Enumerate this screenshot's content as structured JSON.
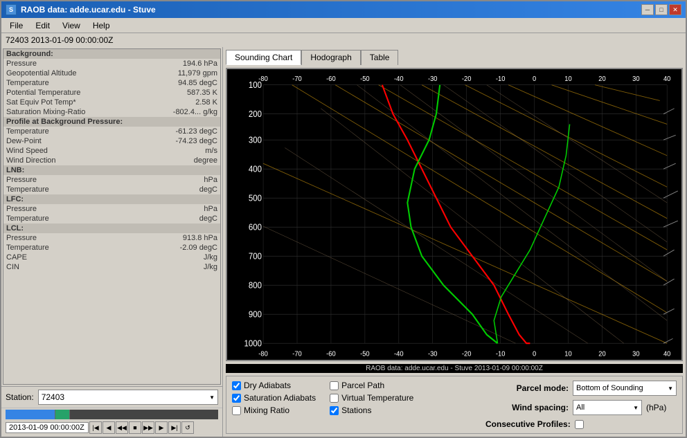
{
  "titleBar": {
    "title": "RAOB data: adde.ucar.edu - Stuve",
    "minimizeBtn": "─",
    "maximizeBtn": "□",
    "closeBtn": "✕"
  },
  "menuBar": {
    "items": [
      "File",
      "Edit",
      "View",
      "Help"
    ]
  },
  "stationInfo": "72403 2013-01-09 00:00:00Z",
  "leftPanel": {
    "sections": [
      {
        "type": "header",
        "label": "Background:",
        "value": ""
      },
      {
        "type": "row",
        "label": "Pressure",
        "value": "194.6 hPa"
      },
      {
        "type": "row",
        "label": "Geopotential Altitude",
        "value": "11,979 gpm"
      },
      {
        "type": "row",
        "label": "Temperature",
        "value": "94.85 degC"
      },
      {
        "type": "row",
        "label": "Potential Temperature",
        "value": "587.35 K"
      },
      {
        "type": "row",
        "label": "Sat Equiv Pot Temp*",
        "value": "2.58 K"
      },
      {
        "type": "row",
        "label": "Saturation Mixing-Ratio",
        "value": "-802.4... g/kg"
      },
      {
        "type": "header",
        "label": "Profile at Background Pressure:",
        "value": ""
      },
      {
        "type": "row",
        "label": "Temperature",
        "value": "-61.23 degC"
      },
      {
        "type": "row",
        "label": "Dew-Point",
        "value": "-74.23 degC"
      },
      {
        "type": "row",
        "label": "Wind Speed",
        "value": "m/s"
      },
      {
        "type": "row",
        "label": "Wind Direction",
        "value": "degree"
      },
      {
        "type": "header",
        "label": "LNB:",
        "value": ""
      },
      {
        "type": "row",
        "label": "Pressure",
        "value": "hPa"
      },
      {
        "type": "row",
        "label": "Temperature",
        "value": "degC"
      },
      {
        "type": "header",
        "label": "LFC:",
        "value": ""
      },
      {
        "type": "row",
        "label": "Pressure",
        "value": "hPa"
      },
      {
        "type": "row",
        "label": "Temperature",
        "value": "degC"
      },
      {
        "type": "header",
        "label": "LCL:",
        "value": ""
      },
      {
        "type": "row",
        "label": "Pressure",
        "value": "913.8 hPa"
      },
      {
        "type": "row",
        "label": "Temperature",
        "value": "-2.09 degC"
      },
      {
        "type": "row",
        "label": "CAPE",
        "value": "J/kg"
      },
      {
        "type": "row",
        "label": "CIN",
        "value": "J/kg"
      }
    ]
  },
  "stationSelect": {
    "label": "Station:",
    "value": "72403"
  },
  "timeDisplay": "2013-01-09 00:00:00Z",
  "tabs": {
    "items": [
      "Sounding Chart",
      "Hodograph",
      "Table"
    ],
    "active": 0
  },
  "chartFooter": "RAOB data: adde.ucar.edu - Stuve 2013-01-09 00:00:00Z",
  "bottomControls": {
    "checkboxGroups": [
      [
        {
          "label": "Dry Adiabats",
          "checked": true
        },
        {
          "label": "Saturation Adiabats",
          "checked": true
        },
        {
          "label": "Mixing Ratio",
          "checked": false
        }
      ],
      [
        {
          "label": "Parcel Path",
          "checked": false
        },
        {
          "label": "Virtual Temperature",
          "checked": false
        },
        {
          "label": "Stations",
          "checked": true
        }
      ]
    ],
    "parcelMode": {
      "label": "Parcel mode:",
      "value": "Bottom of Sounding"
    },
    "windSpacing": {
      "label": "Wind spacing:",
      "value": "All",
      "unit": "(hPa)"
    },
    "consecutiveProfiles": {
      "label": "Consecutive Profiles:",
      "checked": false
    }
  }
}
